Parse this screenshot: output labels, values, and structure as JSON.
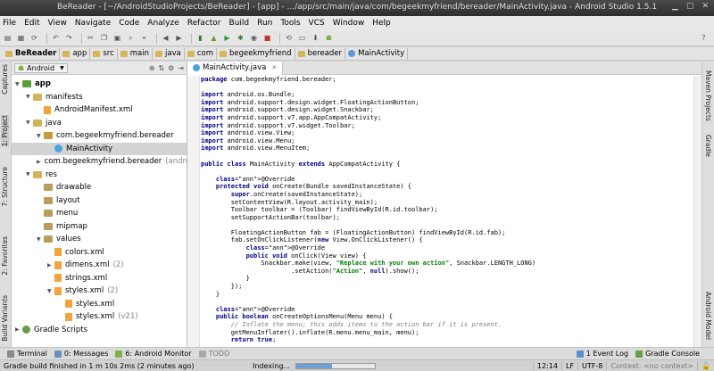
{
  "window": {
    "title": "BeReader - [~/AndroidStudioProjects/BeReader] - [app] - .../app/src/main/java/com/begeekmyfriend/bereader/MainActivity.java - Android Studio 1.5.1"
  },
  "menu": [
    "File",
    "Edit",
    "View",
    "Navigate",
    "Code",
    "Analyze",
    "Refactor",
    "Build",
    "Run",
    "Tools",
    "VCS",
    "Window",
    "Help"
  ],
  "breadcrumb": [
    "BeReader",
    "app",
    "src",
    "main",
    "java",
    "com",
    "begeekmyfriend",
    "bereader",
    "MainActivity"
  ],
  "project_panel": {
    "view_selector": "Android",
    "tree": [
      {
        "label": "app",
        "depth": 0,
        "type": "module",
        "expanded": true
      },
      {
        "label": "manifests",
        "depth": 1,
        "type": "folder",
        "expanded": true
      },
      {
        "label": "AndroidManifest.xml",
        "depth": 2,
        "type": "xml"
      },
      {
        "label": "java",
        "depth": 1,
        "type": "folder",
        "expanded": true
      },
      {
        "label": "com.begeekmyfriend.bereader",
        "depth": 2,
        "type": "package",
        "expanded": true
      },
      {
        "label": "MainActivity",
        "depth": 3,
        "type": "class",
        "selected": true
      },
      {
        "label": "com.begeekmyfriend.bereader",
        "suffix": "(andro",
        "depth": 2,
        "type": "package",
        "expanded": false
      },
      {
        "label": "res",
        "depth": 1,
        "type": "folder",
        "expanded": true
      },
      {
        "label": "drawable",
        "depth": 2,
        "type": "res"
      },
      {
        "label": "layout",
        "depth": 2,
        "type": "res"
      },
      {
        "label": "menu",
        "depth": 2,
        "type": "res"
      },
      {
        "label": "mipmap",
        "depth": 2,
        "type": "res"
      },
      {
        "label": "values",
        "depth": 2,
        "type": "res",
        "expanded": true
      },
      {
        "label": "colors.xml",
        "depth": 3,
        "type": "xml"
      },
      {
        "label": "dimens.xml",
        "suffix": "(2)",
        "depth": 3,
        "type": "xml",
        "expanded": false
      },
      {
        "label": "strings.xml",
        "depth": 3,
        "type": "xml"
      },
      {
        "label": "styles.xml",
        "suffix": "(2)",
        "depth": 3,
        "type": "xml",
        "expanded": true
      },
      {
        "label": "styles.xml",
        "depth": 4,
        "type": "xml"
      },
      {
        "label": "styles.xml",
        "suffix": "(v21)",
        "depth": 4,
        "type": "xml"
      },
      {
        "label": "Gradle Scripts",
        "depth": 0,
        "type": "gradle",
        "expanded": false
      }
    ]
  },
  "left_tabs": [
    "1: Project",
    "Captures",
    "7: Structure",
    "2: Favorites",
    "Build Variants"
  ],
  "right_tabs": [
    "Maven Projects",
    "Gradle",
    "Android Model"
  ],
  "editor": {
    "tab": "MainActivity.java",
    "code": [
      "package com.begeekmyfriend.bereader;",
      "",
      "import android.os.Bundle;",
      "import android.support.design.widget.FloatingActionButton;",
      "import android.support.design.widget.Snackbar;",
      "import android.support.v7.app.AppCompatActivity;",
      "import android.support.v7.widget.Toolbar;",
      "import android.view.View;",
      "import android.view.Menu;",
      "import android.view.MenuItem;",
      "",
      "public class MainActivity extends AppCompatActivity {",
      "",
      "    @Override",
      "    protected void onCreate(Bundle savedInstanceState) {",
      "        super.onCreate(savedInstanceState);",
      "        setContentView(R.layout.activity_main);",
      "        Toolbar toolbar = (Toolbar) findViewById(R.id.toolbar);",
      "        setSupportActionBar(toolbar);",
      "",
      "        FloatingActionButton fab = (FloatingActionButton) findViewById(R.id.fab);",
      "        fab.setOnClickListener(new View.OnClickListener() {",
      "            @Override",
      "            public void onClick(View view) {",
      "                Snackbar.make(view, \"Replace with your own action\", Snackbar.LENGTH_LONG)",
      "                        .setAction(\"Action\", null).show();",
      "            }",
      "        });",
      "    }",
      "",
      "    @Override",
      "    public boolean onCreateOptionsMenu(Menu menu) {",
      "        // Inflate the menu; this adds items to the action bar if it is present.",
      "        getMenuInflater().inflate(R.menu.menu_main, menu);",
      "        return true;"
    ]
  },
  "bottom_tools": {
    "left": [
      "Terminal",
      "0: Messages",
      "6: Android Monitor",
      "TODO"
    ],
    "right": [
      "1 Event Log",
      "Gradle Console"
    ]
  },
  "status": {
    "message": "Gradle build finished in 1 m 10s 2ms (2 minutes ago)",
    "indexing": "Indexing...",
    "progress": 0.45,
    "position": "12:14",
    "line_sep": "LF",
    "encoding": "UTF-8",
    "context": "Context: <no context>"
  }
}
